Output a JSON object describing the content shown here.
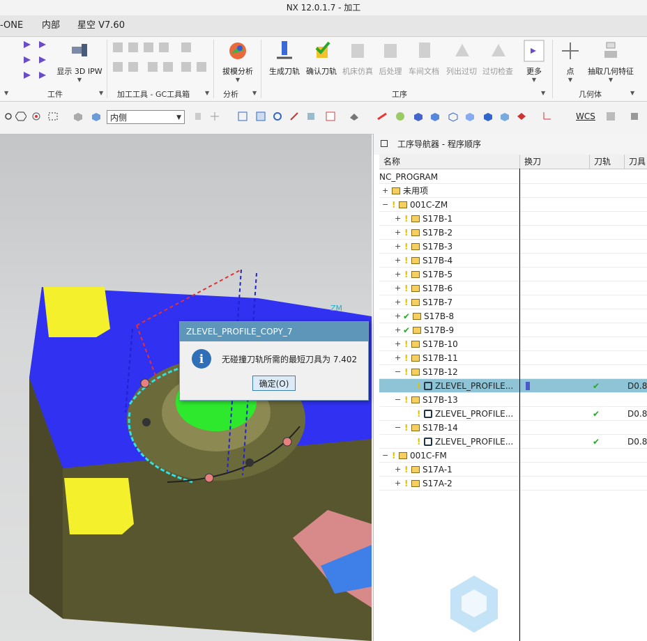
{
  "window": {
    "title": "NX 12.0.1.7 - 加工"
  },
  "menubar": {
    "items": [
      "-ONE",
      "内部",
      "星空 V7.60"
    ]
  },
  "ribbon": {
    "buttons": [
      {
        "label": "显示 3D IPW",
        "disabled": false
      },
      {
        "label": "拔模分析",
        "disabled": false
      },
      {
        "label": "生成刀轨",
        "disabled": false
      },
      {
        "label": "确认刀轨",
        "disabled": false
      },
      {
        "label": "机床仿真",
        "disabled": true
      },
      {
        "label": "后处理",
        "disabled": true
      },
      {
        "label": "车间文档",
        "disabled": true
      },
      {
        "label": "列出过切",
        "disabled": true
      },
      {
        "label": "过切检查",
        "disabled": true
      },
      {
        "label": "更多",
        "disabled": false
      },
      {
        "label": "点",
        "disabled": false
      },
      {
        "label": "抽取几何特征",
        "disabled": false
      }
    ],
    "groups": [
      "工件",
      "加工工具 - GC工具箱",
      "分析",
      "工序",
      "几何体"
    ]
  },
  "toolbar2": {
    "combo_value": "内侧",
    "wcs_label": "WCS"
  },
  "viewport": {
    "axis_label": "ZM"
  },
  "navigator": {
    "title": "工序导航器 - 程序顺序",
    "columns": [
      "名称",
      "换刀",
      "刀轨",
      "刀具"
    ],
    "rows": [
      {
        "name": "NC_PROGRAM",
        "level": 0,
        "type": "root"
      },
      {
        "name": "未用项",
        "level": 1,
        "type": "group",
        "expand": "+"
      },
      {
        "name": "001C-ZM",
        "level": 1,
        "type": "program",
        "expand": "-",
        "status": "warn"
      },
      {
        "name": "S17B-1",
        "level": 2,
        "type": "program",
        "expand": "+",
        "status": "warn"
      },
      {
        "name": "S17B-2",
        "level": 2,
        "type": "program",
        "expand": "+",
        "status": "warn"
      },
      {
        "name": "S17B-3",
        "level": 2,
        "type": "program",
        "expand": "+",
        "status": "warn"
      },
      {
        "name": "S17B-4",
        "level": 2,
        "type": "program",
        "expand": "+",
        "status": "warn"
      },
      {
        "name": "S17B-5",
        "level": 2,
        "type": "program",
        "expand": "+",
        "status": "warn"
      },
      {
        "name": "S17B-6",
        "level": 2,
        "type": "program",
        "expand": "+",
        "status": "warn"
      },
      {
        "name": "S17B-7",
        "level": 2,
        "type": "program",
        "expand": "+",
        "status": "warn"
      },
      {
        "name": "S17B-8",
        "level": 2,
        "type": "program",
        "expand": "+",
        "status": "ok"
      },
      {
        "name": "S17B-9",
        "level": 2,
        "type": "program",
        "expand": "+",
        "status": "ok"
      },
      {
        "name": "S17B-10",
        "level": 2,
        "type": "program",
        "expand": "+",
        "status": "warn"
      },
      {
        "name": "S17B-11",
        "level": 2,
        "type": "program",
        "expand": "+",
        "status": "warn"
      },
      {
        "name": "S17B-12",
        "level": 2,
        "type": "program",
        "expand": "-",
        "status": "warn"
      },
      {
        "name": "ZLEVEL_PROFILE...",
        "level": 3,
        "type": "op",
        "status": "warn",
        "tool_change": true,
        "path_ok": true,
        "tool": "D0.8",
        "selected": true
      },
      {
        "name": "S17B-13",
        "level": 2,
        "type": "program",
        "expand": "-",
        "status": "warn"
      },
      {
        "name": "ZLEVEL_PROFILE...",
        "level": 3,
        "type": "op",
        "status": "warn",
        "path_ok": true,
        "tool": "D0.8"
      },
      {
        "name": "S17B-14",
        "level": 2,
        "type": "program",
        "expand": "-",
        "status": "warn"
      },
      {
        "name": "ZLEVEL_PROFILE...",
        "level": 3,
        "type": "op",
        "status": "warn",
        "path_ok": true,
        "tool": "D0.8"
      },
      {
        "name": "001C-FM",
        "level": 1,
        "type": "program",
        "expand": "-",
        "status": "warn"
      },
      {
        "name": "S17A-1",
        "level": 2,
        "type": "program",
        "expand": "+",
        "status": "warn"
      },
      {
        "name": "S17A-2",
        "level": 2,
        "type": "program",
        "expand": "+",
        "status": "warn"
      }
    ]
  },
  "dialog": {
    "title": "ZLEVEL_PROFILE_COPY_7",
    "message": "无碰撞刀轨所需的最短刀具为 7.402",
    "ok_label": "确定(O)"
  },
  "colors": {
    "part_blue": "#3131f2",
    "part_olive": "#58562f",
    "pad_yellow": "#f4f02b",
    "green_face": "#2ee82e",
    "dialog_title": "#5e96ba",
    "selected_row": "#8fc4d6"
  }
}
